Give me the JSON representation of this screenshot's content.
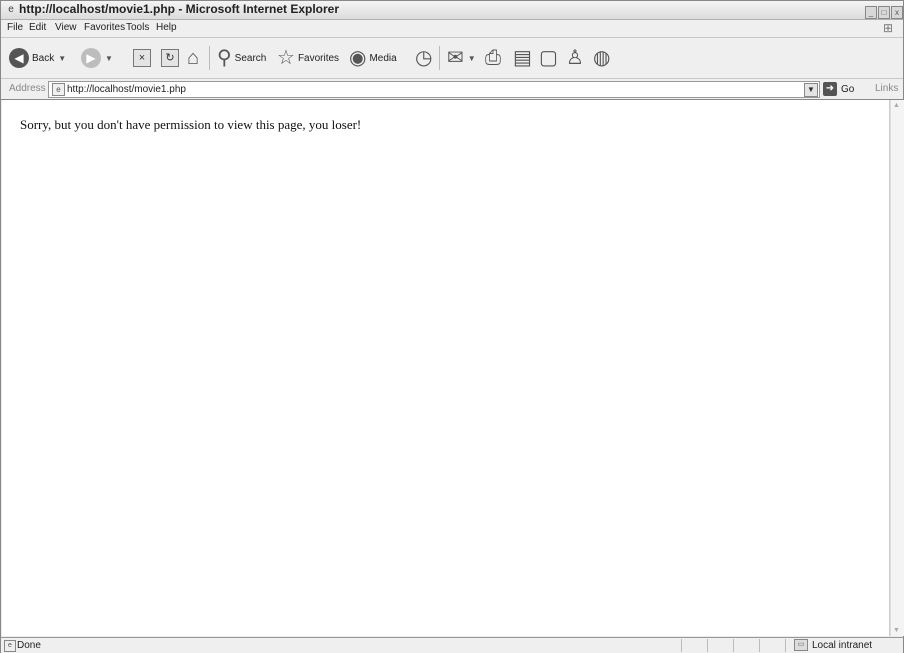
{
  "window": {
    "title": "http://localhost/movie1.php - Microsoft Internet Explorer"
  },
  "menu": {
    "items": [
      "File",
      "Edit",
      "View",
      "Favorites",
      "Tools",
      "Help"
    ]
  },
  "toolbar": {
    "back_label": "Back",
    "search_label": "Search",
    "favorites_label": "Favorites",
    "media_label": "Media"
  },
  "address": {
    "label": "Address",
    "url": "http://localhost/movie1.php",
    "go_label": "Go",
    "links_label": "Links"
  },
  "page": {
    "message": "Sorry, but you don't have permission to view this page, you loser!"
  },
  "status": {
    "text": "Done",
    "zone": "Local intranet"
  },
  "icons": {
    "back": "back-arrow-icon",
    "forward": "forward-arrow-icon",
    "stop": "stop-icon",
    "refresh": "refresh-icon",
    "home": "home-icon",
    "search": "search-magnifier-icon",
    "favorites": "favorites-star-icon",
    "media": "media-icon",
    "history": "history-icon",
    "mail": "mail-icon",
    "print": "print-icon",
    "edit": "edit-icon",
    "discuss": "discuss-icon",
    "messenger": "messenger-icon",
    "research": "research-icon"
  }
}
